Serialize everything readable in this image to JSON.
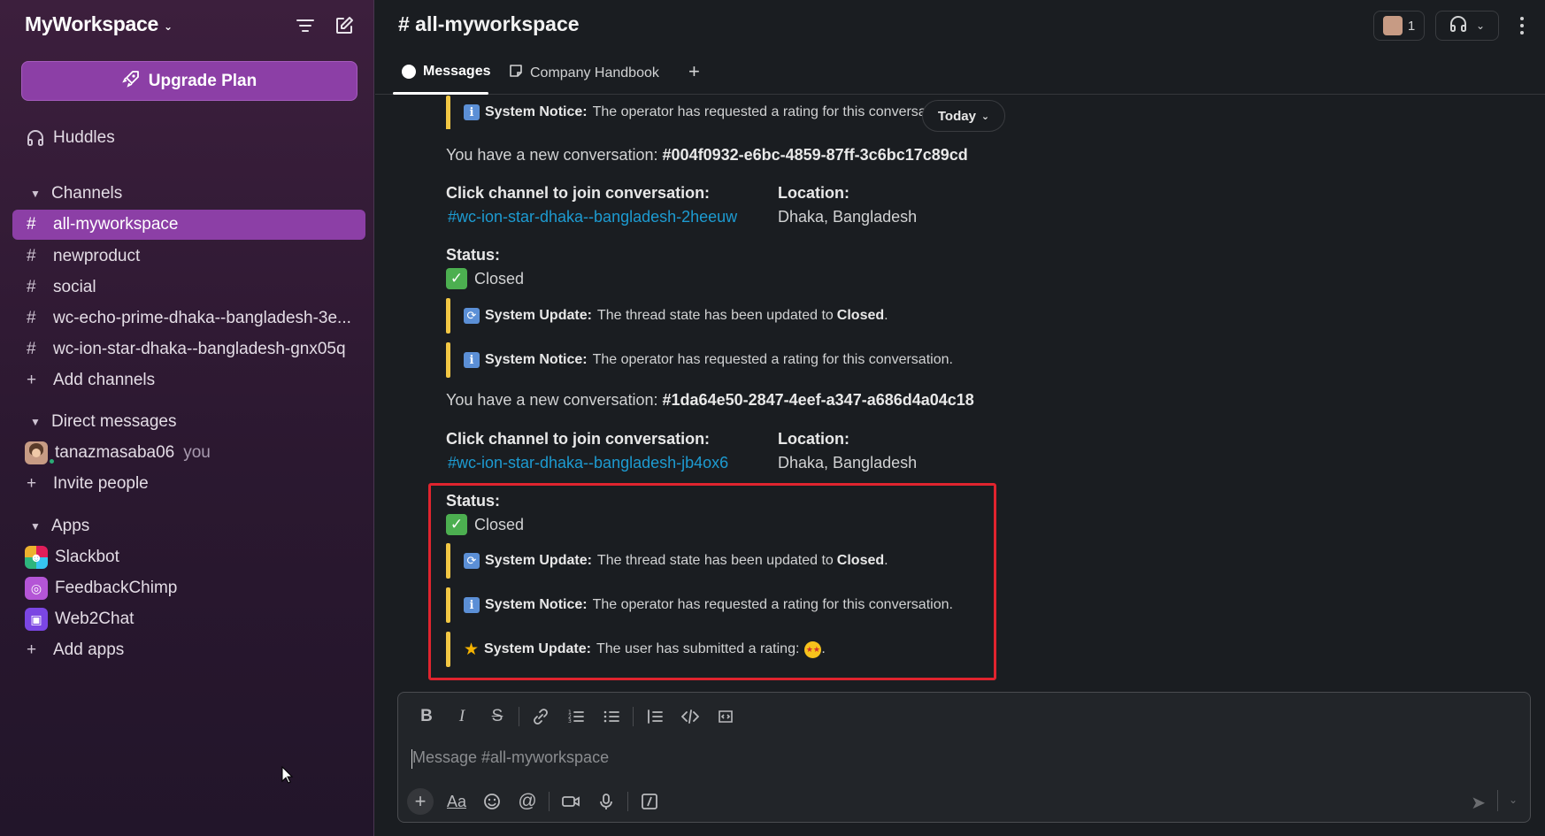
{
  "workspace": {
    "name": "MyWorkspace"
  },
  "sidebar": {
    "upgrade_label": "Upgrade Plan",
    "huddles_label": "Huddles",
    "channels_header": "Channels",
    "channels": [
      "all-myworkspace",
      "newproduct",
      "social",
      "wc-echo-prime-dhaka--bangladesh-3e...",
      "wc-ion-star-dhaka--bangladesh-gnx05q"
    ],
    "add_channels": "Add channels",
    "dm_header": "Direct messages",
    "dm_user": "tanazmasaba06",
    "dm_you": "you",
    "invite": "Invite people",
    "apps_header": "Apps",
    "apps": [
      "Slackbot",
      "FeedbackChimp",
      "Web2Chat"
    ],
    "add_apps": "Add apps"
  },
  "header": {
    "channel_title": "# all-myworkspace",
    "member_count": "1",
    "tabs": [
      "Messages",
      "Company Handbook"
    ]
  },
  "messages": {
    "notice_label": "System Notice:",
    "notice_text_truncated": "The operator has requested a rating for this conversat",
    "notice_text": "The operator has requested a rating for this conversation.",
    "update_label": "System Update:",
    "update_text": "The thread state has been updated to",
    "closed_word": "Closed",
    "closed_period": ".",
    "today": "Today",
    "new_conv_prefix": "You have a new conversation:",
    "conv1_id": "#004f0932-e6bc-4859-87ff-3c6bc17c89cd",
    "conv2_id": "#1da64e50-2847-4eef-a347-a686d4a04c18",
    "join_label": "Click channel to join conversation:",
    "location_label": "Location:",
    "conv1_channel": "#wc-ion-star-dhaka--bangladesh-2heeuw",
    "conv2_channel": "#wc-ion-star-dhaka--bangladesh-jb4ox6",
    "location_value": "Dhaka, Bangladesh",
    "status_label": "Status:",
    "status_value": "Closed",
    "rating_text": "The user has submitted a rating:",
    "rating_end": "."
  },
  "composer": {
    "placeholder": "Message #all-myworkspace"
  },
  "colors": {
    "accent": "#8c3fa6",
    "link": "#1d9bd1",
    "quote_bar": "#f2c744",
    "highlight": "#e0242e"
  }
}
